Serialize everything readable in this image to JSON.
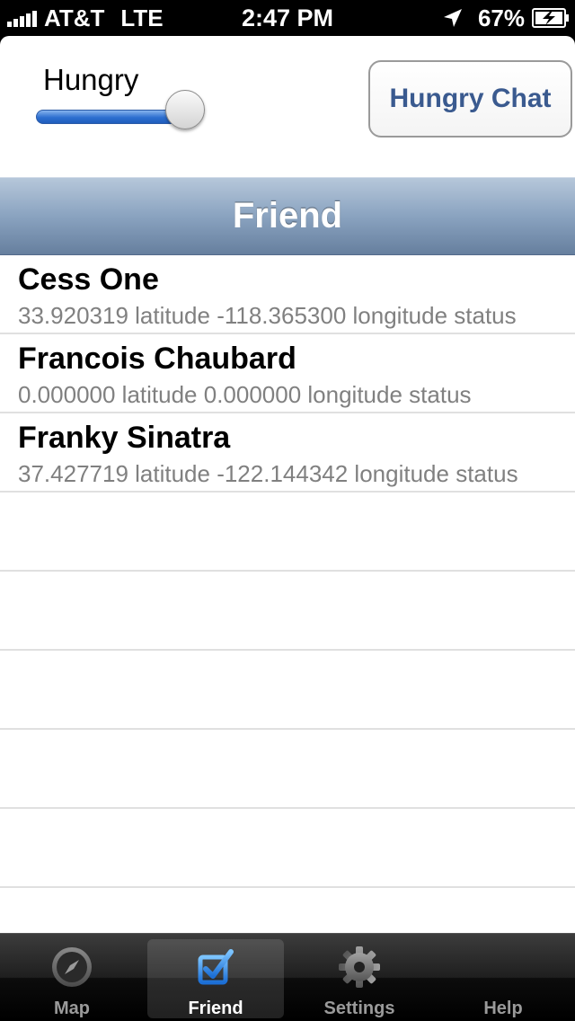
{
  "status_bar": {
    "carrier": "AT&T",
    "network": "LTE",
    "time": "2:47 PM",
    "battery": "67%",
    "icons": [
      "signal-bars-icon",
      "location-arrow-icon",
      "battery-charging-icon"
    ]
  },
  "controls": {
    "slider_label": "Hungry",
    "slider_value": 1.0,
    "chat_button": "Hungry Chat"
  },
  "section": {
    "title": "Friend"
  },
  "friends": [
    {
      "name": "Cess One",
      "detail": "33.920319 latitude -118.365300 longitude  status"
    },
    {
      "name": "Francois Chaubard",
      "detail": "0.000000 latitude 0.000000 longitude  status"
    },
    {
      "name": "Franky Sinatra",
      "detail": "37.427719 latitude -122.144342 longitude  status"
    }
  ],
  "tabs": [
    {
      "label": "Map",
      "icon": "compass-icon",
      "selected": false
    },
    {
      "label": "Friend",
      "icon": "checkbox-icon",
      "selected": true
    },
    {
      "label": "Settings",
      "icon": "gear-icon",
      "selected": false
    },
    {
      "label": "Help",
      "icon": "help-icon",
      "selected": false
    }
  ],
  "colors": {
    "accent_blue": "#2d6fd0",
    "header_gradient_top": "#b6c7da",
    "header_gradient_bottom": "#667f9e",
    "button_text": "#3a5a8f",
    "tab_selected_icon": "#2f8be8"
  }
}
